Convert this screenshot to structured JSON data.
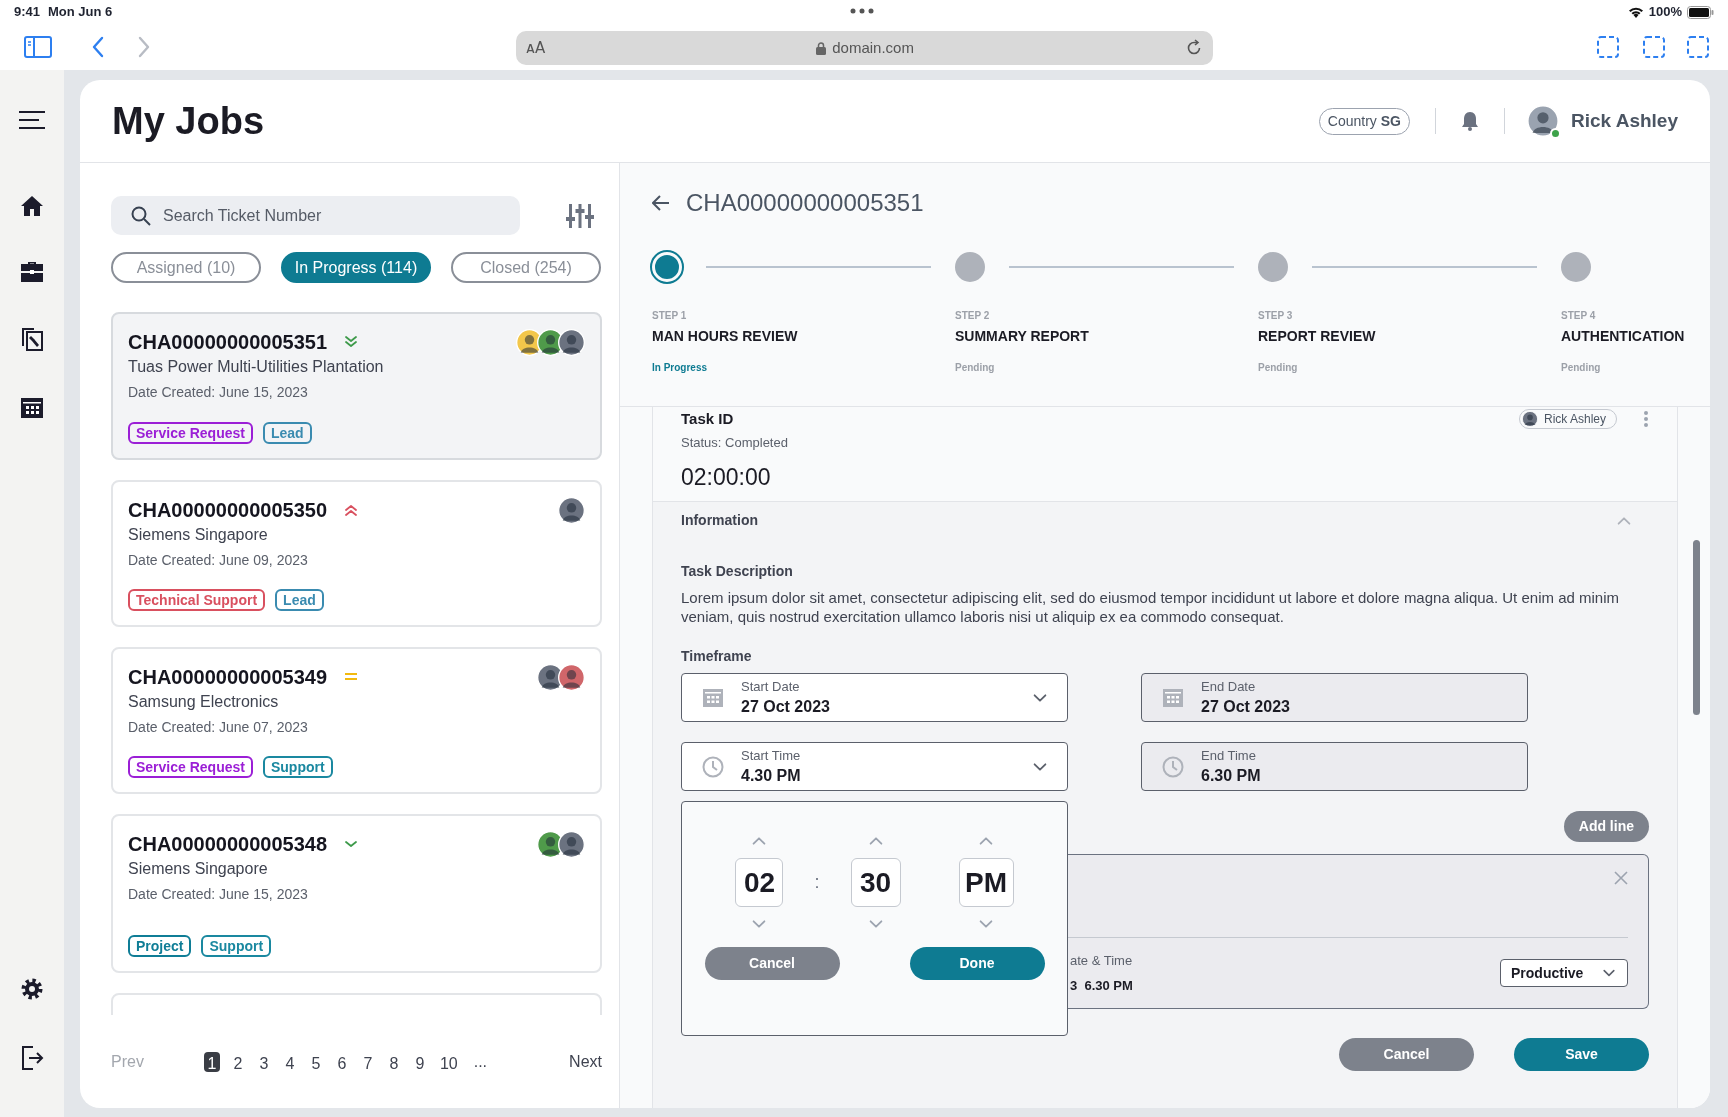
{
  "status_bar": {
    "time": "9:41",
    "date": "Mon Jun 6",
    "battery": "100%"
  },
  "browser": {
    "text_size": "ᴀA",
    "url": "domain.com",
    "forward_disabled": true
  },
  "header": {
    "title": "My Jobs",
    "country": "Country **SG**",
    "user": "Rick Ashley",
    "online": true
  },
  "search": {
    "placeholder": "Search Ticket Number"
  },
  "filter_tabs": [
    {
      "label": "Assigned (10)",
      "selected": false
    },
    {
      "label": "In Progress (114)",
      "selected": true
    },
    {
      "label": "Closed (254)",
      "selected": false
    }
  ],
  "jobs": [
    {
      "ticket": "CHA00000000005351",
      "kind": "lowest",
      "company": "Tuas Power Multi-Utilities Plantation",
      "date": "Date Created: June 15, 2023",
      "selected": true,
      "avatars": [
        {
          "color": "#f3c74a"
        },
        {
          "color": "#4f9a4a"
        },
        {
          "color": "#6b7280"
        }
      ],
      "tags": [
        {
          "label": "Service Request",
          "color": "#9b1fd6"
        },
        {
          "label": "Lead",
          "color": "#3a8bb0"
        }
      ]
    },
    {
      "ticket": "CHA00000000005350",
      "kind": "highest",
      "company": "Siemens Singapore",
      "date": "Date Created: June 09, 2023",
      "selected": false,
      "avatars": [
        {
          "color": "#6b7280"
        }
      ],
      "tags": [
        {
          "label": "Technical Support",
          "color": "#d9505f"
        },
        {
          "label": "Lead",
          "color": "#3a8bb0"
        }
      ]
    },
    {
      "ticket": "CHA00000000005349",
      "kind": "medium",
      "company": "Samsung Electronics",
      "date": "Date Created: June 07, 2023",
      "selected": false,
      "avatars": [
        {
          "color": "#6b7280"
        },
        {
          "color": "#d0666a"
        }
      ],
      "tags": [
        {
          "label": "Service Request",
          "color": "#9b1fd6"
        },
        {
          "label": "Support",
          "color": "#1a88a0"
        }
      ]
    },
    {
      "ticket": "CHA00000000005348",
      "kind": "low",
      "company": "Siemens Singapore",
      "date": "Date Created: June 15, 2023",
      "selected": false,
      "avatars": [
        {
          "color": "#4f9a4a"
        },
        {
          "color": "#6b7280"
        }
      ],
      "tags": [
        {
          "label": "Project",
          "color": "#0f7d96"
        },
        {
          "label": "Support",
          "color": "#1a88a0"
        }
      ]
    }
  ],
  "pagination": {
    "prev": {
      "label": "Prev",
      "disabled": true
    },
    "pages": [
      {
        "label": "1",
        "selected": true
      },
      {
        "label": "2",
        "selected": false
      },
      {
        "label": "3",
        "selected": false
      },
      {
        "label": "4",
        "selected": false
      },
      {
        "label": "5",
        "selected": false
      },
      {
        "label": "6",
        "selected": false
      },
      {
        "label": "7",
        "selected": false
      },
      {
        "label": "8",
        "selected": false
      },
      {
        "label": "9",
        "selected": false
      },
      {
        "label": "10",
        "selected": false
      }
    ],
    "ellipsis": "...",
    "next": {
      "label": "Next",
      "disabled": false
    }
  },
  "detail": {
    "ticket": "CHA00000000005351",
    "steps": [
      {
        "step": "STEP 1",
        "name": "MAN HOURS REVIEW",
        "status": "In Progress",
        "active": true
      },
      {
        "step": "STEP 2",
        "name": "SUMMARY REPORT",
        "status": "Pending",
        "active": false
      },
      {
        "step": "STEP 3",
        "name": "REPORT REVIEW",
        "status": "Pending",
        "active": false
      },
      {
        "step": "STEP 4",
        "name": "AUTHENTICATION",
        "status": "Pending",
        "active": false
      }
    ],
    "task": {
      "title": "Task ID",
      "assignee": "Rick Ashley",
      "status": "Status: Completed",
      "duration": "02:00:00"
    },
    "information": {
      "title": "Information",
      "expanded": true,
      "description_label": "Task Description",
      "description": "Lorem ipsum dolor sit amet, consectetur adipiscing elit, sed do eiusmod tempor incididunt ut labore et dolore magna aliqua. Ut enim ad minim veniam, quis nostrud exercitation ullamco laboris nisi ut aliquip ex ea commodo consequat.",
      "timeframe_label": "Timeframe",
      "fields": [
        {
          "label": "Start Date",
          "value": "27 Oct 2023",
          "kind": "date",
          "editable": true
        },
        {
          "label": "End Date",
          "value": "27 Oct 2023",
          "kind": "date",
          "editable": false
        },
        {
          "label": "Start Time",
          "value": "4.30 PM",
          "kind": "time",
          "editable": true
        },
        {
          "label": "End Time",
          "value": "6.30 PM",
          "kind": "time",
          "editable": false
        }
      ]
    },
    "time_picker": {
      "hour": "02",
      "separator": ":",
      "minute": "30",
      "period": "PM",
      "cancel": "Cancel",
      "done": "Done"
    },
    "add_line": "Add line",
    "line": {
      "label": "ate & Time",
      "value": "3  6.30 PM",
      "type": "Productive"
    },
    "actions": {
      "cancel": "Cancel",
      "save": "Save"
    }
  }
}
